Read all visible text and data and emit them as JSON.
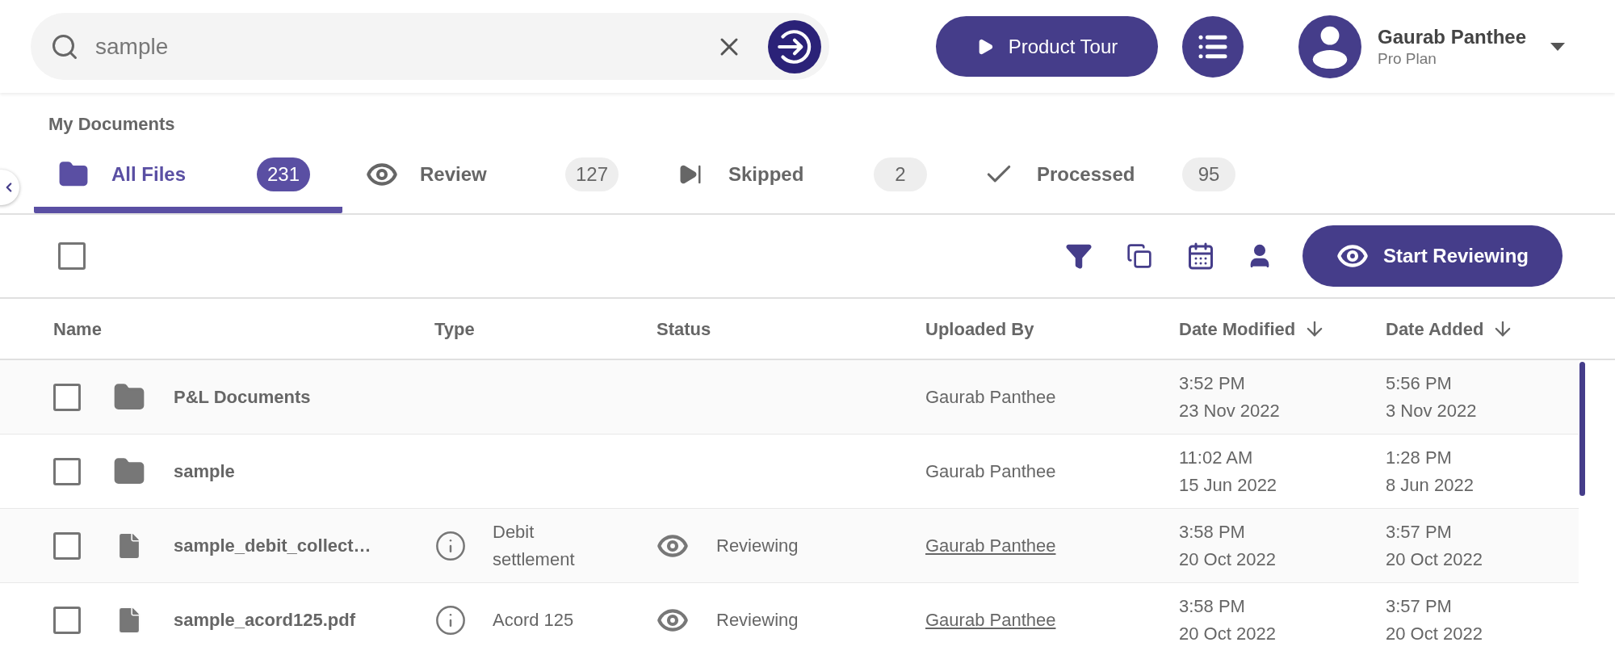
{
  "search": {
    "value": "sample"
  },
  "header": {
    "tour_button": "Product Tour",
    "user": {
      "name": "Gaurab Panthee",
      "plan": "Pro Plan"
    }
  },
  "page_title": "My Documents",
  "tabs": [
    {
      "kind": "all",
      "label": "All Files",
      "count": "231",
      "selected": true
    },
    {
      "kind": "review",
      "label": "Review",
      "count": "127",
      "selected": false
    },
    {
      "kind": "skipped",
      "label": "Skipped",
      "count": "2",
      "selected": false
    },
    {
      "kind": "processed",
      "label": "Processed",
      "count": "95",
      "selected": false
    }
  ],
  "toolbar": {
    "select_all_checked": false,
    "start_button": "Start Reviewing"
  },
  "table": {
    "columns": [
      {
        "label": "Name",
        "sorted": false
      },
      {
        "label": "Type",
        "sorted": false
      },
      {
        "label": "Status",
        "sorted": false
      },
      {
        "label": "Uploaded By",
        "sorted": false
      },
      {
        "label": "Date Modified",
        "sorted": true
      },
      {
        "label": "Date Added",
        "sorted": true
      }
    ],
    "rows": [
      {
        "kind": "folder",
        "checked": false,
        "name": "P&L Documents",
        "uploaded_by": "Gaurab Panthee",
        "uploader_link": false,
        "modified_time": "3:52 PM",
        "modified_date": "23 Nov 2022",
        "added_time": "5:56 PM",
        "added_date": "3 Nov 2022"
      },
      {
        "kind": "folder",
        "checked": false,
        "name": "sample",
        "uploaded_by": "Gaurab Panthee",
        "uploader_link": false,
        "modified_time": "11:02 AM",
        "modified_date": "15 Jun 2022",
        "added_time": "1:28 PM",
        "added_date": "8 Jun 2022"
      },
      {
        "kind": "file",
        "checked": false,
        "name": "sample_debit_collect…",
        "type": "Debit settlement",
        "status": "Reviewing",
        "uploaded_by": "Gaurab Panthee",
        "uploader_link": true,
        "modified_time": "3:58 PM",
        "modified_date": "20 Oct 2022",
        "added_time": "3:57 PM",
        "added_date": "20 Oct 2022"
      },
      {
        "kind": "file",
        "checked": false,
        "name": "sample_acord125.pdf",
        "type": "Acord 125",
        "status": "Reviewing",
        "uploaded_by": "Gaurab Panthee",
        "uploader_link": true,
        "modified_time": "3:58 PM",
        "modified_date": "20 Oct 2022",
        "added_time": "3:57 PM",
        "added_date": "20 Oct 2022"
      }
    ]
  }
}
